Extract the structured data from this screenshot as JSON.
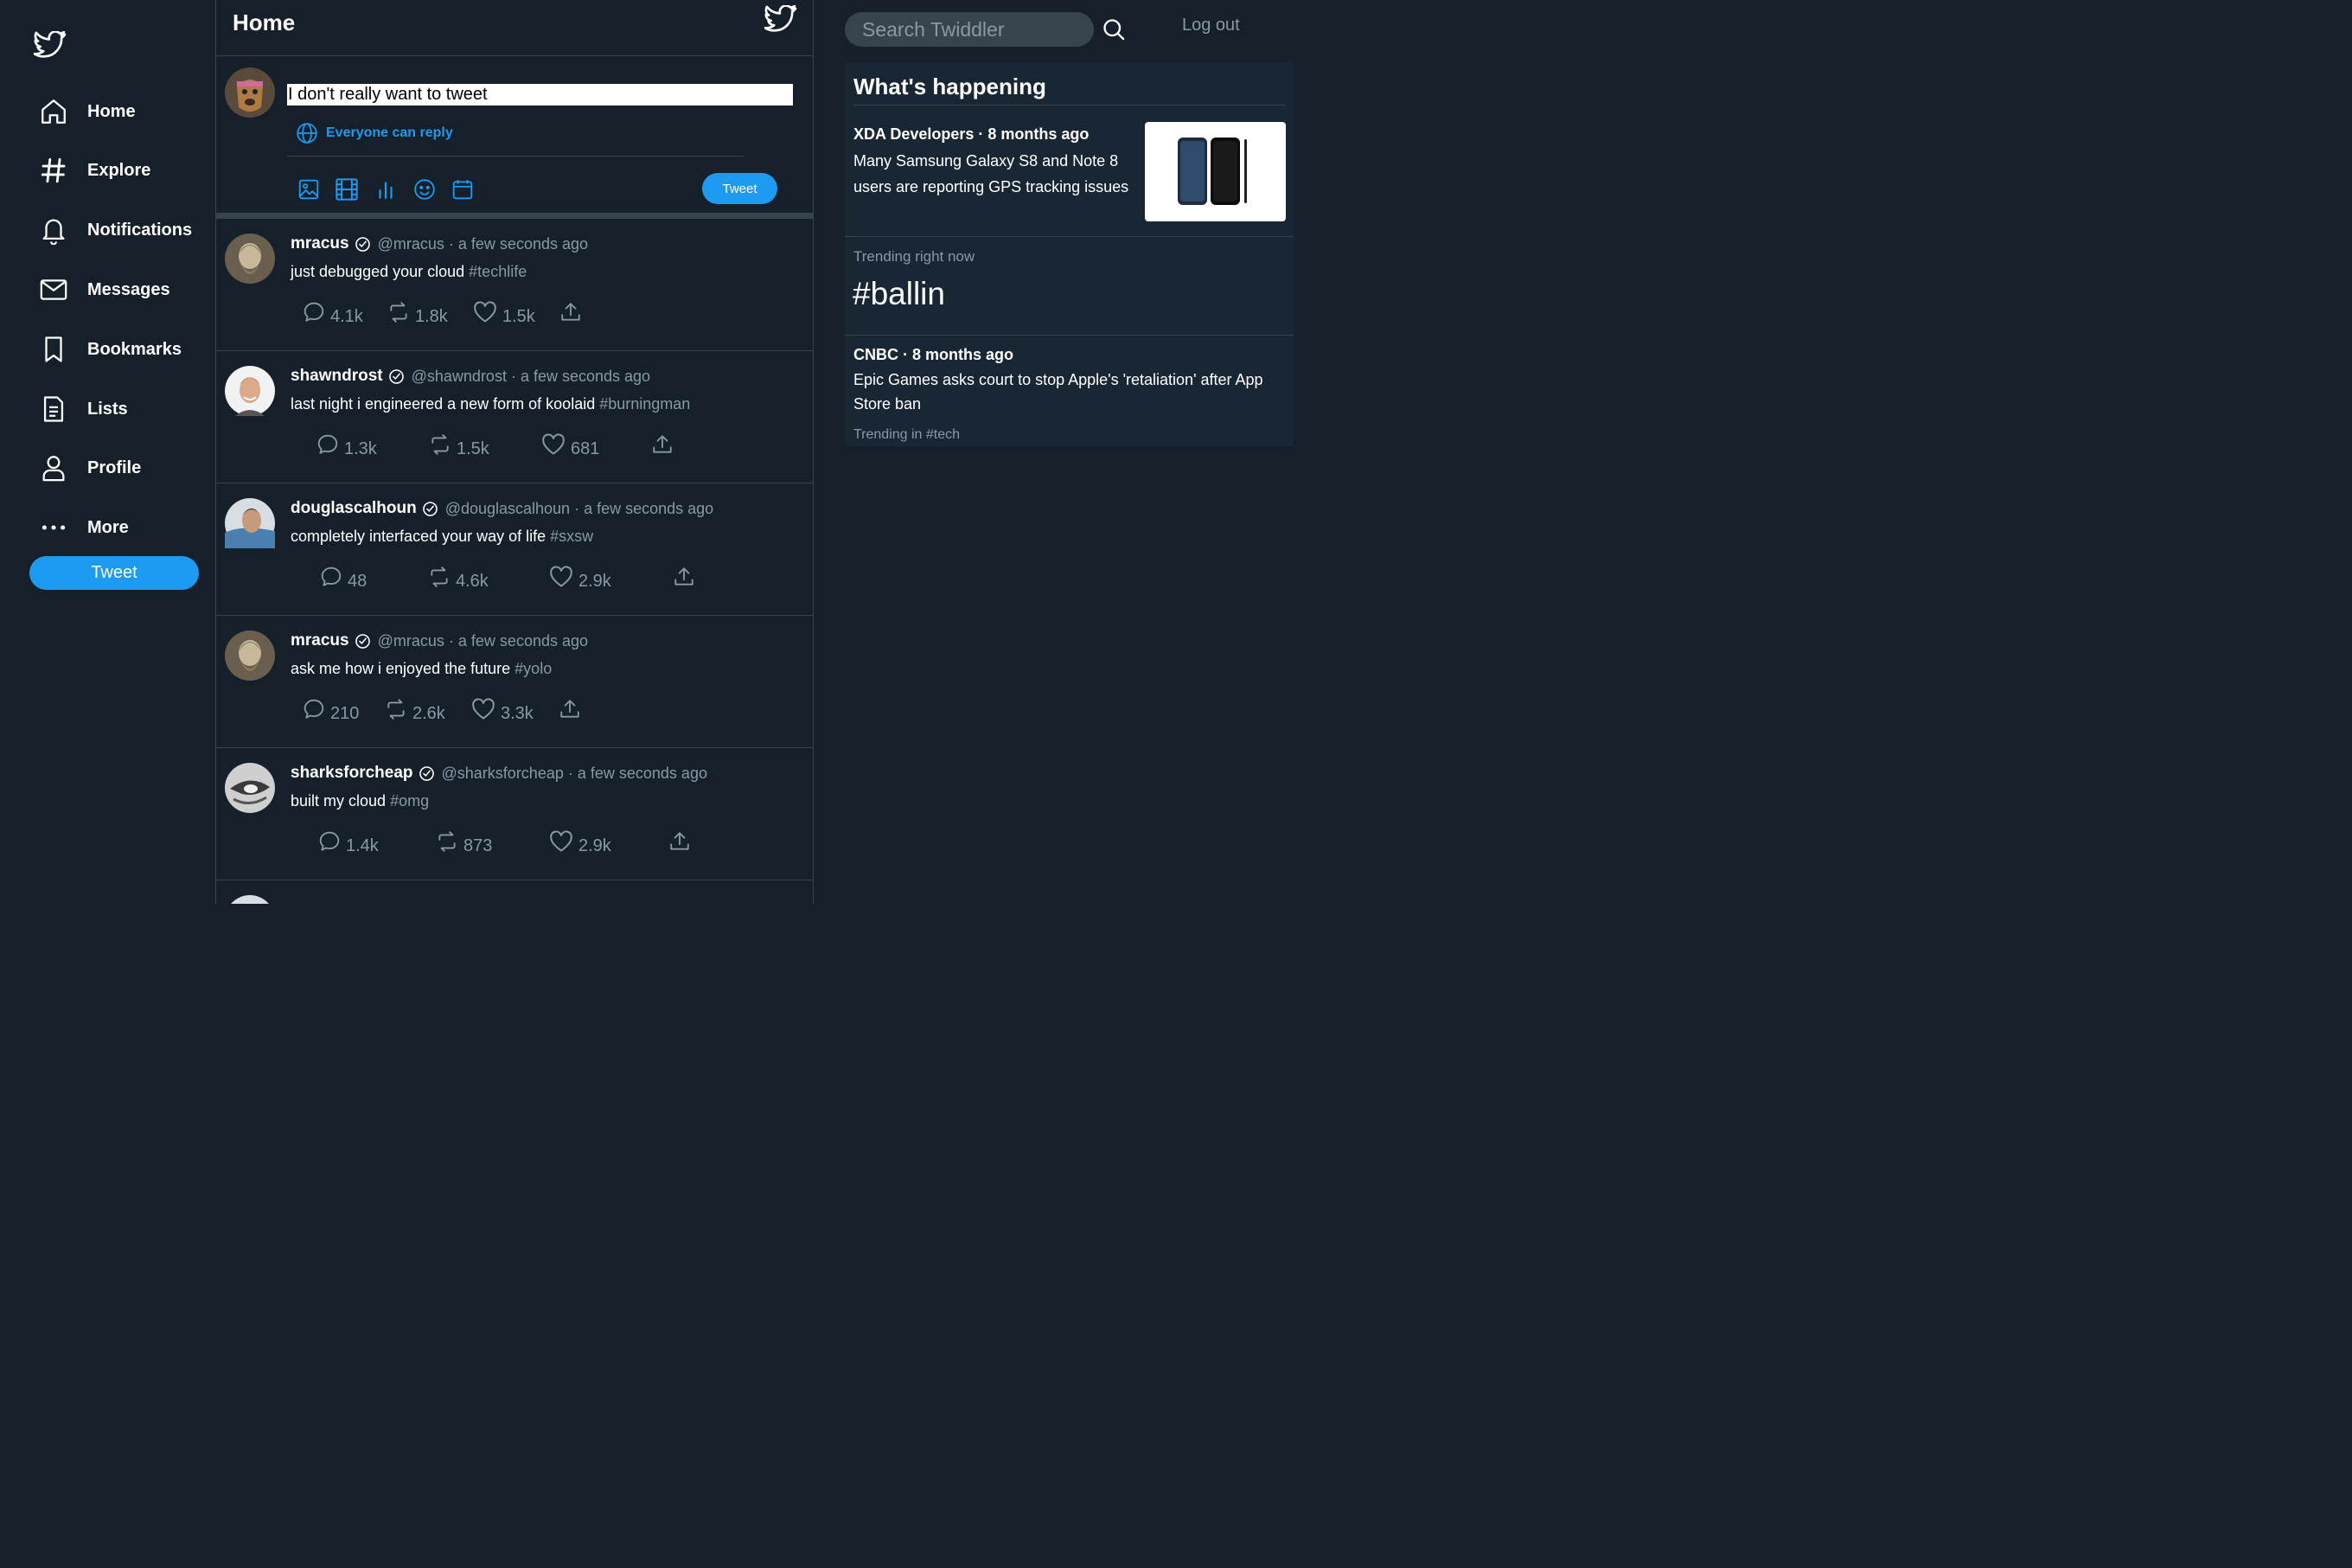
{
  "colors": {
    "background": "#15202b",
    "accent": "#1d9bf0",
    "muted": "#8899a6",
    "border": "#38444d",
    "card": "#192734"
  },
  "nav": {
    "logo_icon": "twitter-bird-icon",
    "items": [
      {
        "label": "Home",
        "icon": "home-icon"
      },
      {
        "label": "Explore",
        "icon": "hashtag-icon"
      },
      {
        "label": "Notifications",
        "icon": "bell-icon"
      },
      {
        "label": "Messages",
        "icon": "envelope-icon"
      },
      {
        "label": "Bookmarks",
        "icon": "bookmark-icon"
      },
      {
        "label": "Lists",
        "icon": "list-document-icon"
      },
      {
        "label": "Profile",
        "icon": "person-icon"
      },
      {
        "label": "More",
        "icon": "more-dots-icon"
      }
    ],
    "tweet_button": "Tweet"
  },
  "header": {
    "title": "Home"
  },
  "compose": {
    "value": "I don't really want to tweet",
    "reply_setting": "Everyone can reply",
    "tools": [
      "image-icon",
      "gif-film-icon",
      "poll-icon",
      "emoji-icon",
      "schedule-icon"
    ],
    "tweet_button": "Tweet"
  },
  "tweets": [
    {
      "name": "mracus",
      "handle": "@mracus",
      "time": "a few seconds ago",
      "text": "just debugged your cloud",
      "tag": "#techlife",
      "replies": "4.1k",
      "retweets": "1.8k",
      "likes": "1.5k"
    },
    {
      "name": "shawndrost",
      "handle": "@shawndrost",
      "time": "a few seconds ago",
      "text": "last night i engineered a new form of koolaid",
      "tag": "#burningman",
      "replies": "1.3k",
      "retweets": "1.5k",
      "likes": "681"
    },
    {
      "name": "douglascalhoun",
      "handle": "@douglascalhoun",
      "time": "a few seconds ago",
      "text": "completely interfaced your way of life",
      "tag": "#sxsw",
      "replies": "48",
      "retweets": "4.6k",
      "likes": "2.9k"
    },
    {
      "name": "mracus",
      "handle": "@mracus",
      "time": "a few seconds ago",
      "text": "ask me how i enjoyed the future",
      "tag": "#yolo",
      "replies": "210",
      "retweets": "2.6k",
      "likes": "3.3k"
    },
    {
      "name": "sharksforcheap",
      "handle": "@sharksforcheap",
      "time": "a few seconds ago",
      "text": "built my cloud",
      "tag": "#omg",
      "replies": "1.4k",
      "retweets": "873",
      "likes": "2.9k"
    }
  ],
  "search": {
    "placeholder": "Search Twiddler"
  },
  "logout": "Log out",
  "trends": {
    "title": "What's happening",
    "items": [
      {
        "source": "XDA Developers · 8 months ago",
        "text": "Many Samsung Galaxy S8 and Note 8 users are reporting GPS tracking issues"
      },
      {
        "label": "Trending right now",
        "tag": "#ballin"
      },
      {
        "source": "CNBC · 8 months ago",
        "text": "Epic Games asks court to stop Apple's 'retaliation' after App Store ban",
        "sub": "Trending in #tech"
      }
    ]
  }
}
